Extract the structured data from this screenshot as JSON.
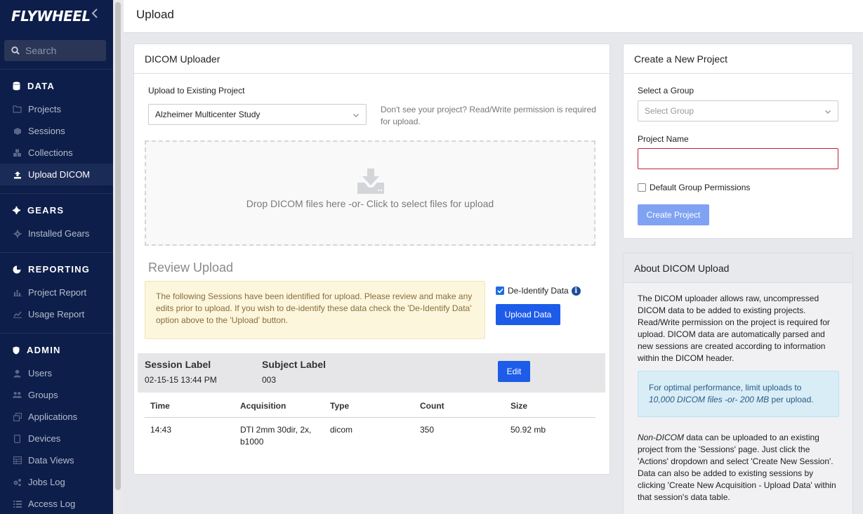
{
  "sidebar": {
    "logo": "FLYWHEEL",
    "search_placeholder": "Search",
    "sections": {
      "data": {
        "title": "DATA",
        "items": [
          "Projects",
          "Sessions",
          "Collections",
          "Upload DICOM"
        ]
      },
      "gears": {
        "title": "GEARS",
        "items": [
          "Installed Gears"
        ]
      },
      "reporting": {
        "title": "REPORTING",
        "items": [
          "Project Report",
          "Usage Report"
        ]
      },
      "admin": {
        "title": "ADMIN",
        "items": [
          "Users",
          "Groups",
          "Applications",
          "Devices",
          "Data Views",
          "Jobs Log",
          "Access Log"
        ]
      }
    },
    "active_item": "Upload DICOM"
  },
  "header": {
    "title": "Upload"
  },
  "uploader": {
    "title": "DICOM Uploader",
    "project_label": "Upload to Existing Project",
    "project_value": "Alzheimer Multicenter Study",
    "project_hint": "Don't see your project? Read/Write permission is required for upload.",
    "dropzone_text": "Drop DICOM files here -or- Click to select files for upload",
    "review_title": "Review Upload",
    "alert_text": "The following Sessions have been identified for upload. Please review and make any edits prior to upload. If you wish to de-identify these data check the 'De-Identify Data' option above to the 'Upload' button.",
    "deidentify_label": "De-Identify Data",
    "deidentify_checked": true,
    "upload_button": "Upload Data",
    "session": {
      "session_label_head": "Session Label",
      "session_label": "02-15-15 13:44 PM",
      "subject_label_head": "Subject Label",
      "subject_label": "003",
      "edit_button": "Edit"
    },
    "table": {
      "columns": [
        "Time",
        "Acquisition",
        "Type",
        "Count",
        "Size"
      ],
      "rows": [
        [
          "14:43",
          "DTI 2mm 30dir, 2x, b1000",
          "dicom",
          "350",
          "50.92 mb"
        ]
      ]
    }
  },
  "create_project": {
    "title": "Create a New Project",
    "group_label": "Select a Group",
    "group_placeholder": "Select Group",
    "name_label": "Project Name",
    "name_value": "",
    "default_perm_label": "Default Group Permissions",
    "create_button": "Create Project"
  },
  "about": {
    "title": "About DICOM Upload",
    "para1": "The DICOM uploader allows raw, uncompressed DICOM data to be added to existing projects. Read/Write permission on the project is required for upload. DICOM data are automatically parsed and new sessions are created according to information within the DICOM header.",
    "info_prefix": "For optimal performance, limit uploads to",
    "info_emph": "10,000 DICOM files -or- 200 MB",
    "info_suffix": "per upload.",
    "para2_emph": "Non-DICOM",
    "para2": "data can be uploaded to an existing project from the 'Sessions' page. Just click the 'Actions' dropdown and select 'Create New Session'. Data can also be added to existing sessions by clicking 'Create New Acquisition - Upload Data' within that session's data table."
  },
  "colors": {
    "sidebar_bg": "#0d1e4a",
    "primary": "#1d5ce8",
    "alert_bg": "#fcf6dd",
    "info_bg": "#d9edf7",
    "error_border": "#c0213a"
  }
}
